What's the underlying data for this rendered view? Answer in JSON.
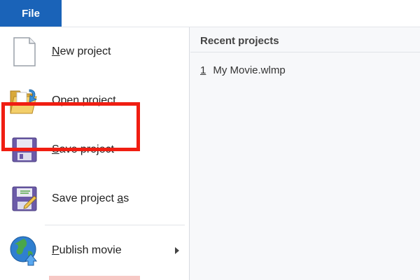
{
  "ribbon": {
    "file_tab": "File"
  },
  "menu": {
    "items": [
      {
        "label": "New project",
        "mnemonic": "N",
        "rest": "ew project",
        "icon": "blank-page-icon"
      },
      {
        "label": "Open project",
        "mnemonic": "O",
        "rest": "pen project",
        "icon": "open-folder-icon"
      },
      {
        "label": "Save project",
        "mnemonic": "S",
        "rest": "ave project",
        "icon": "floppy-disk-icon"
      },
      {
        "label": "Save project as",
        "prefix": "Save project ",
        "mnemonic": "a",
        "rest": "s",
        "icon": "save-as-icon"
      },
      {
        "label": "Publish movie",
        "mnemonic": "P",
        "rest": "ublish movie",
        "icon": "globe-upload-icon"
      }
    ]
  },
  "recent": {
    "header": "Recent projects",
    "items": [
      {
        "number": "1",
        "name": "My Movie.wlmp"
      }
    ]
  },
  "colors": {
    "file_tab": "#1a63b8",
    "highlight": "#f01e12",
    "floppy": "#6b5aa8"
  }
}
